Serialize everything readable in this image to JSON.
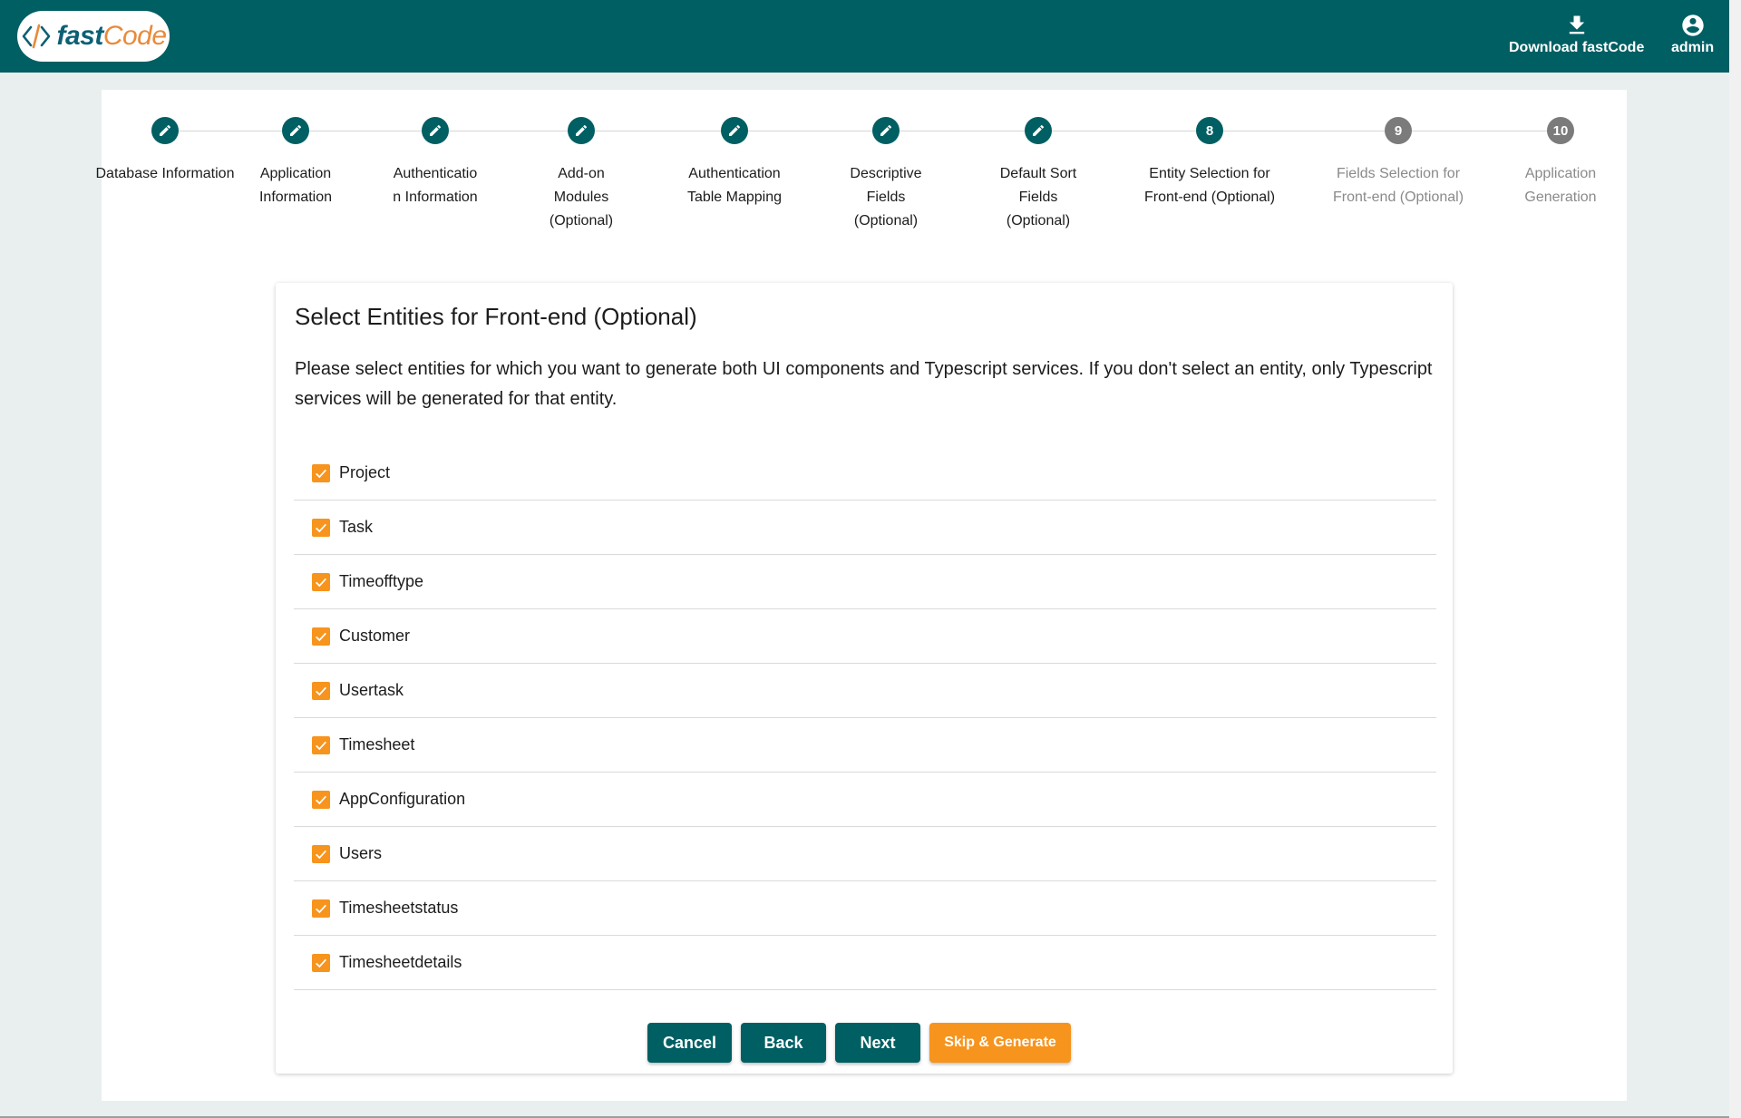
{
  "header": {
    "logo": {
      "fast": "fast",
      "code": "Code"
    },
    "download_label": "Download fastCode",
    "admin_label": "admin"
  },
  "stepper": {
    "steps": [
      {
        "label": "Database Information",
        "state": "done"
      },
      {
        "label": "Application Information",
        "state": "done"
      },
      {
        "label": "Authenticatio n Information",
        "state": "done"
      },
      {
        "label": "Add-on Modules (Optional)",
        "state": "done"
      },
      {
        "label": "Authentication Table Mapping",
        "state": "done"
      },
      {
        "label": "Descriptive Fields (Optional)",
        "state": "done"
      },
      {
        "label": "Default Sort Fields (Optional)",
        "state": "done"
      },
      {
        "label": "Entity Selection for Front-end (Optional)",
        "state": "active",
        "number": "8"
      },
      {
        "label": "Fields Selection for Front-end (Optional)",
        "state": "pending",
        "number": "9"
      },
      {
        "label": "Application Generation",
        "state": "pending",
        "number": "10"
      }
    ]
  },
  "card": {
    "title": "Select Entities for Front-end (Optional)",
    "description": "Please select entities for which you want to generate both UI components and Typescript services. If you don't select an entity, only Typescript services will be generated for that entity."
  },
  "entities": [
    {
      "label": "Project",
      "checked": true
    },
    {
      "label": "Task",
      "checked": true
    },
    {
      "label": "Timeofftype",
      "checked": true
    },
    {
      "label": "Customer",
      "checked": true
    },
    {
      "label": "Usertask",
      "checked": true
    },
    {
      "label": "Timesheet",
      "checked": true
    },
    {
      "label": "AppConfiguration",
      "checked": true
    },
    {
      "label": "Users",
      "checked": true
    },
    {
      "label": "Timesheetstatus",
      "checked": true
    },
    {
      "label": "Timesheetdetails",
      "checked": true
    }
  ],
  "actions": {
    "cancel_label": "Cancel",
    "back_label": "Back",
    "next_label": "Next",
    "skip_label": "Skip & Generate"
  },
  "colors": {
    "primary": "#005f63",
    "accent": "#f7941d",
    "pending": "#7b7b7b"
  },
  "icons": {
    "done_step": "pencil-icon",
    "checkbox": "check-icon",
    "download": "download-icon",
    "admin": "account-circle-icon"
  }
}
